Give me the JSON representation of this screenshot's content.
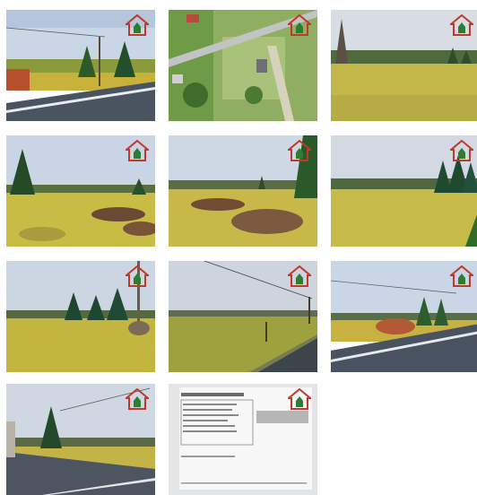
{
  "gallery": {
    "watermark_icon": "house-logo-icon",
    "accent_color": "#c0392b",
    "photos": [
      {
        "name": "photo-road-meadow",
        "scene": "road"
      },
      {
        "name": "photo-aerial-map",
        "scene": "aerial"
      },
      {
        "name": "photo-meadow-treeline",
        "scene": "meadow"
      },
      {
        "name": "photo-meadow-spruce",
        "scene": "meadow-spruce"
      },
      {
        "name": "photo-meadow-bushes",
        "scene": "meadow-bush"
      },
      {
        "name": "photo-meadow-forest",
        "scene": "meadow-forest"
      },
      {
        "name": "photo-meadow-pole",
        "scene": "meadow-pole"
      },
      {
        "name": "photo-road-field",
        "scene": "road2"
      },
      {
        "name": "photo-road-trees",
        "scene": "road3"
      },
      {
        "name": "photo-road-houses",
        "scene": "road4"
      },
      {
        "name": "photo-document-scan",
        "scene": "document"
      }
    ]
  }
}
